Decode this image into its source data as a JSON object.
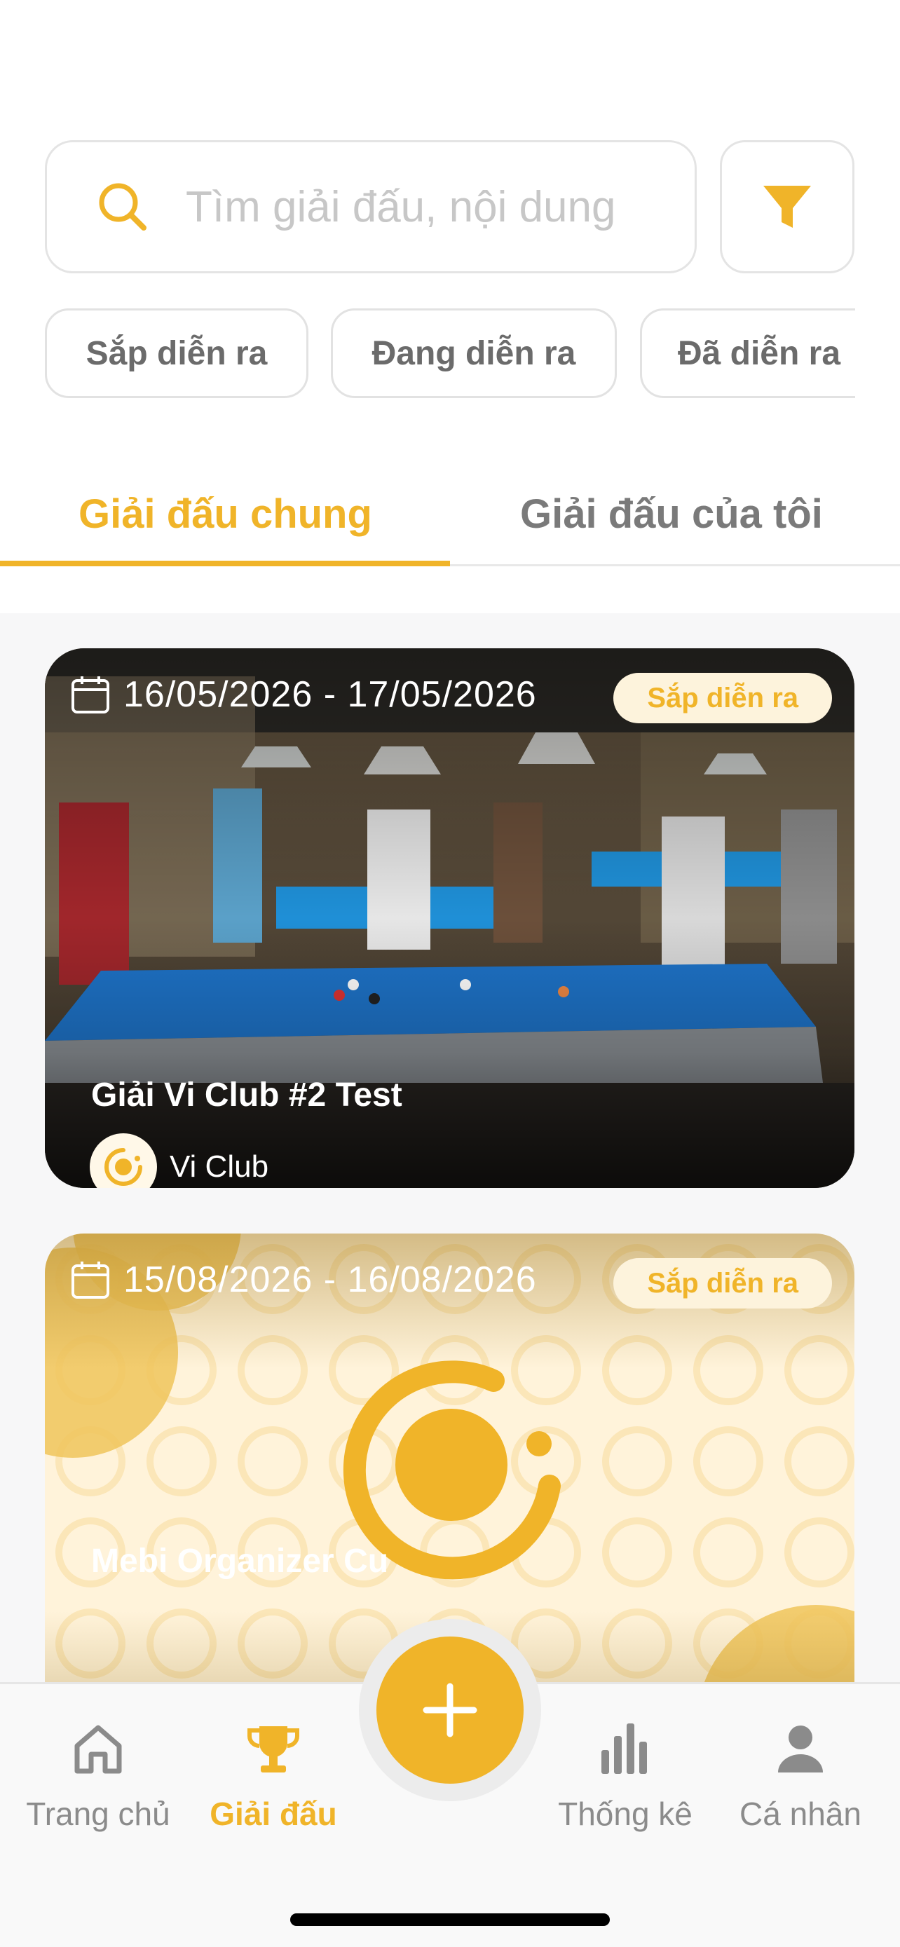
{
  "search": {
    "placeholder": "Tìm giải đấu, nội dung"
  },
  "filters": {
    "chips": [
      "Sắp diễn ra",
      "Đang diễn ra",
      "Đã diễn ra"
    ]
  },
  "tabs": [
    {
      "label": "Giải đấu chung",
      "active": true
    },
    {
      "label": "Giải đấu của tôi",
      "active": false
    }
  ],
  "tournaments": [
    {
      "date_range": "16/05/2026 - 17/05/2026",
      "status": "Sắp diễn ra",
      "title": "Giải Vi Club #2 Test",
      "organizer": "Vi Club",
      "image": "billiards-hall-photo"
    },
    {
      "date_range": "15/08/2026 - 16/08/2026",
      "status": "Sắp diễn ra",
      "title": "Mebi Organizer Cu",
      "image": "mebi-logo-pattern"
    }
  ],
  "bottom_nav": [
    {
      "label": "Trang chủ",
      "icon": "home-icon",
      "active": false
    },
    {
      "label": "Giải đấu",
      "icon": "trophy-icon",
      "active": true
    },
    {
      "label": "Thống kê",
      "icon": "bar-chart-icon",
      "active": false
    },
    {
      "label": "Cá nhân",
      "icon": "person-icon",
      "active": false
    }
  ],
  "fab": {
    "icon": "plus-icon"
  },
  "colors": {
    "accent": "#f0b429",
    "badge_bg": "#fdf3dc",
    "inactive": "#8b8b8b"
  }
}
